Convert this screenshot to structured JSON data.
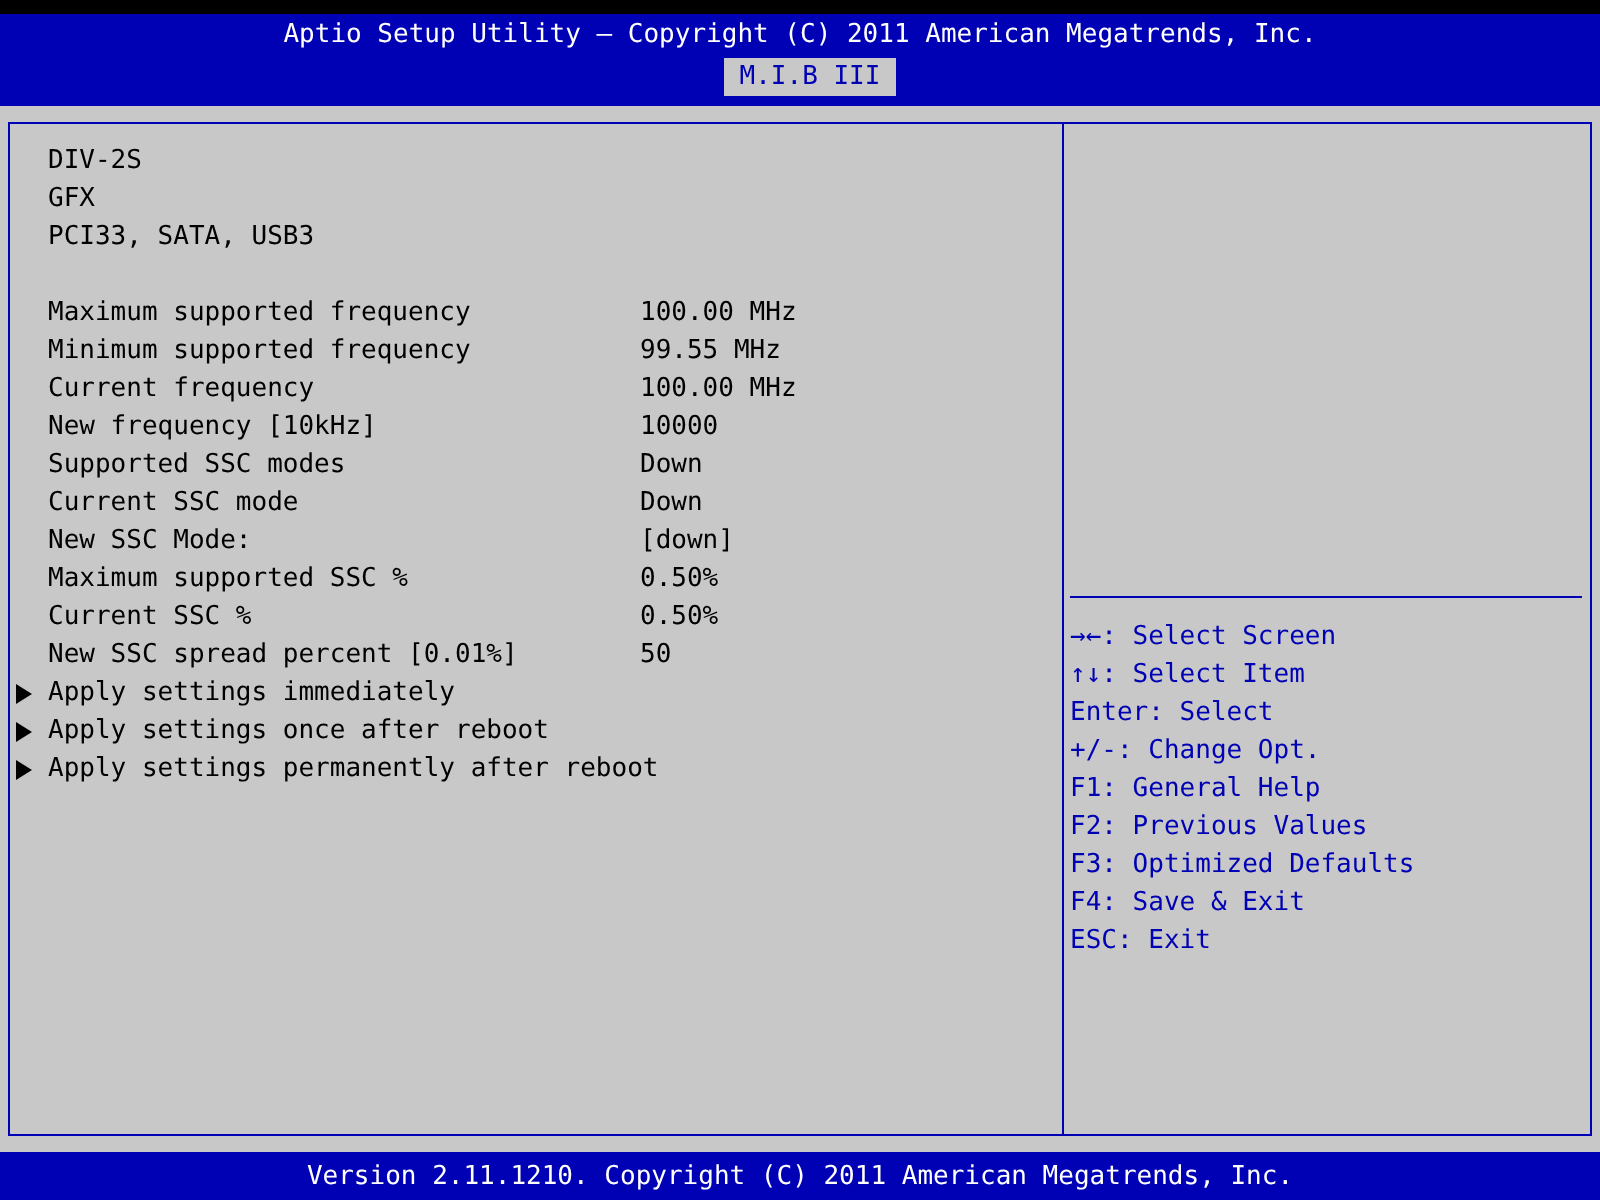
{
  "header": {
    "title": "Aptio Setup Utility – Copyright (C) 2011 American Megatrends, Inc.",
    "tabs": [
      {
        "label": "M.I.B III",
        "selected": true
      }
    ]
  },
  "info_lines": [
    "DIV-2S",
    "GFX",
    "PCI33, SATA, USB3"
  ],
  "settings": [
    {
      "label": "Maximum supported frequency",
      "value": "100.00 MHz"
    },
    {
      "label": "Minimum supported frequency",
      "value": "99.55 MHz"
    },
    {
      "label": "Current frequency",
      "value": "100.00 MHz"
    },
    {
      "label": "New frequency [10kHz]",
      "value": "10000"
    },
    {
      "label": "Supported SSC modes",
      "value": "Down"
    },
    {
      "label": "Current SSC mode",
      "value": "Down"
    },
    {
      "label": "New SSC Mode:",
      "value": "[down]"
    },
    {
      "label": "Maximum supported SSC %",
      "value": "0.50%"
    },
    {
      "label": "Current SSC %",
      "value": "0.50%"
    },
    {
      "label": "New SSC spread percent [0.01%]",
      "value": "50"
    }
  ],
  "submenus": [
    "Apply settings immediately",
    "Apply settings once after reboot",
    "Apply settings permanently after reboot"
  ],
  "help": [
    "→←: Select Screen",
    "↑↓: Select Item",
    "Enter: Select",
    "+/-: Change Opt.",
    "F1: General Help",
    "F2: Previous Values",
    "F3: Optimized Defaults",
    "F4: Save & Exit",
    "ESC: Exit"
  ],
  "footer": "Version 2.11.1210. Copyright (C) 2011 American Megatrends, Inc."
}
